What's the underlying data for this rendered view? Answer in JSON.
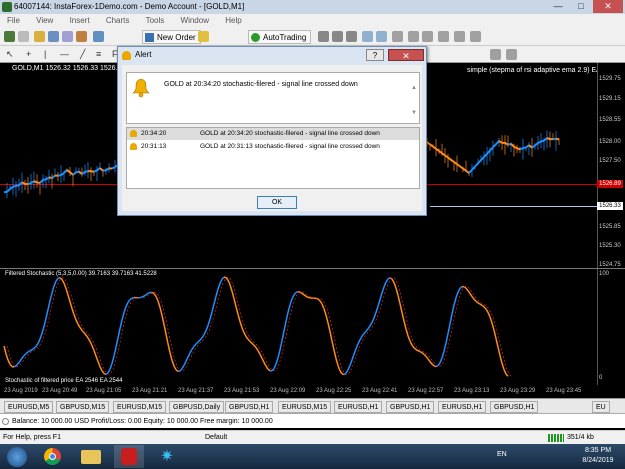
{
  "window": {
    "title": "64007144: InstaForex-1Demo.com - Demo Account - [GOLD,M1]",
    "minimize": "—",
    "maximize": "□",
    "close": "✕"
  },
  "menu": [
    "File",
    "View",
    "Insert",
    "Charts",
    "Tools",
    "Window",
    "Help"
  ],
  "toolbar": {
    "new_order": "New Order",
    "autotrading": "AutoTrading"
  },
  "chart": {
    "symbol_label": "GOLD,M1  1526.32 1526.33 1526.32 1526.33",
    "expert_label": "simple (stepma of rsi adaptive ema 2.9) EA_1",
    "price_ticks": [
      "1529.75",
      "1529.15",
      "1528.55",
      "1528.00",
      "1527.50",
      "1526.90",
      "1526.33",
      "1525.85",
      "1525.30",
      "1524.75"
    ],
    "price_red": "1526.89",
    "price_current": "1526.33",
    "stoch_label": "Filtered Stochastic (5,3,5,0.00) 39.7163 39.7163 41.5228",
    "stoch2_label": "Stochastic of filtered price EA 2546 EA 2544",
    "stoch_top_tick": "100",
    "stoch_bottom_tick": "0",
    "time_ticks": [
      "23 Aug 2019",
      "23 Aug 20:49",
      "23 Aug 21:05",
      "23 Aug 21:21",
      "23 Aug 21:37",
      "23 Aug 21:53",
      "23 Aug 22:09",
      "23 Aug 22:25",
      "23 Aug 22:41",
      "23 Aug 22:57",
      "23 Aug 23:13",
      "23 Aug 23:29",
      "23 Aug 23:45"
    ]
  },
  "tabs": [
    "EURUSD,M5",
    "GBPUSD,M15",
    "EURUSD,M15",
    "GBPUSD,Daily",
    "GBPUSD,H1",
    "EURUSD,M15",
    "EURUSD,H1",
    "GBPUSD,H1",
    "EURUSD,H1",
    "GBPUSD,H1",
    "EU"
  ],
  "balance": "Balance: 10 000.00 USD  Profit/Loss: 0.00  Equity: 10 000.00  Free margin: 10 000.00",
  "status": {
    "help": "For Help, press F1",
    "profile": "Default",
    "traffic": "351/4 kb"
  },
  "taskbar": {
    "lang": "EN",
    "time": "8:35 PM",
    "date": "8/24/2019"
  },
  "alert": {
    "title": "Alert",
    "help": "?",
    "close": "✕",
    "message": "GOLD at 20:34:20 stochastic-filered - signal line crossed down",
    "rows": [
      {
        "time": "20:34:20",
        "text": "GOLD at 20:34:20 stochastic-filered - signal line crossed down"
      },
      {
        "time": "20:31:13",
        "text": "GOLD at 20:31:13 stochastic-filered - signal line crossed down"
      }
    ],
    "ok": "OK"
  },
  "colors": {
    "up_line": "#1e90ff",
    "down_line": "#ff8c1a",
    "signal": "#ff3030",
    "bell": "#e8a800"
  }
}
